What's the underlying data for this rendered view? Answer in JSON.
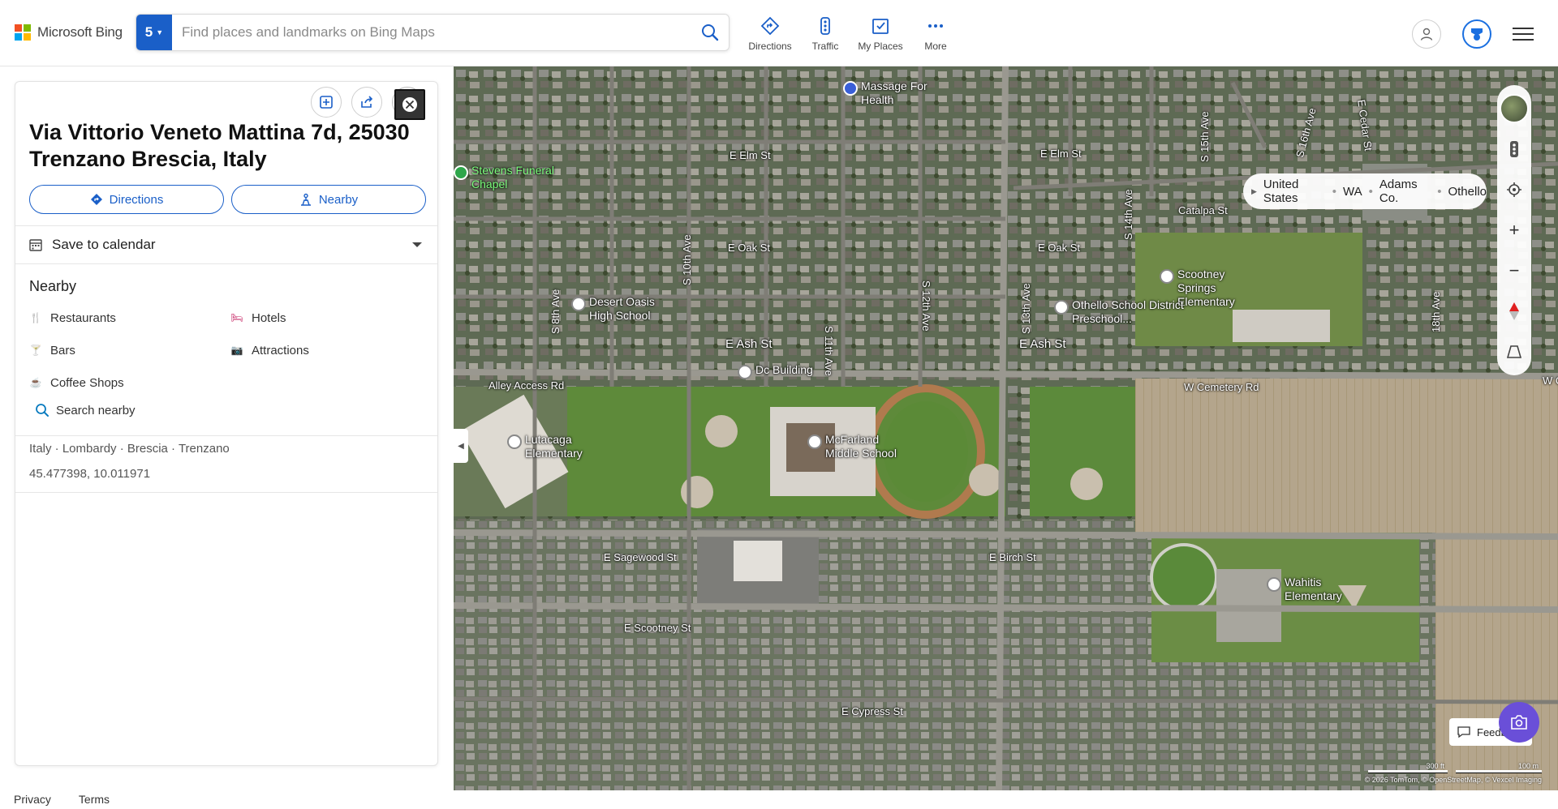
{
  "brand": {
    "name": "Microsoft Bing",
    "colors": [
      "#f25022",
      "#7fba00",
      "#00a4ef",
      "#ffb900"
    ]
  },
  "search": {
    "badge": "5",
    "placeholder": "Find places and landmarks on Bing Maps",
    "value": ""
  },
  "topnav": [
    {
      "label": "Directions",
      "icon": "directions-icon"
    },
    {
      "label": "Traffic",
      "icon": "traffic-icon"
    },
    {
      "label": "My Places",
      "icon": "my-places-icon"
    },
    {
      "label": "More",
      "icon": "more-icon"
    }
  ],
  "panel": {
    "title": "Via Vittorio Veneto Mattina 7d, 25030 Trenzano Brescia, Italy",
    "directions_label": "Directions",
    "nearby_button_label": "Nearby",
    "calendar_label": "Save to calendar",
    "nearby_title": "Nearby",
    "nearby_items": [
      {
        "label": "Restaurants",
        "icon": "fork-knife-icon",
        "color": "#e87722"
      },
      {
        "label": "Hotels",
        "icon": "bed-icon",
        "color": "#c2185b"
      },
      {
        "label": "Bars",
        "icon": "cocktail-icon",
        "color": "#e87722"
      },
      {
        "label": "Attractions",
        "icon": "camera-icon",
        "color": "#1a7fc8"
      },
      {
        "label": "Coffee Shops",
        "icon": "coffee-icon",
        "color": "#e87722"
      }
    ],
    "search_nearby_label": "Search nearby",
    "address_breadcrumb": "Italy · Lombardy · Brescia · Trenzano",
    "coordinates": "45.477398, 10.011971"
  },
  "footer": {
    "privacy": "Privacy",
    "terms": "Terms"
  },
  "map": {
    "breadcrumb": [
      "United States",
      "WA",
      "Adams Co.",
      "Othello"
    ],
    "streets": [
      {
        "name": "E Elm St"
      },
      {
        "name": "E Elm St "
      },
      {
        "name": "E Oak St"
      },
      {
        "name": "E Oak St "
      },
      {
        "name": "E Ash St"
      },
      {
        "name": "E Ash St "
      },
      {
        "name": "Alley Access Rd"
      },
      {
        "name": "W Cemetery Rd"
      },
      {
        "name": "Catalpa St"
      },
      {
        "name": "E Sagewood St"
      },
      {
        "name": "E Birch St"
      },
      {
        "name": "E Scootney St"
      },
      {
        "name": "E Cypress St"
      },
      {
        "name": "S 8th Ave"
      },
      {
        "name": "S 10th Ave"
      },
      {
        "name": "S 11th Ave"
      },
      {
        "name": "S 12th Ave"
      },
      {
        "name": "S 13th Ave"
      },
      {
        "name": "S 14th Ave"
      },
      {
        "name": "S 15th Ave"
      },
      {
        "name": "S 16th Ave"
      },
      {
        "name": "18th Ave"
      },
      {
        "name": "E Cedar St"
      },
      {
        "name": "W Ce"
      }
    ],
    "pois": [
      {
        "name": "Massage For Health"
      },
      {
        "name": "Stevens Funeral Chapel"
      },
      {
        "name": "Desert Oasis High School"
      },
      {
        "name": "Scootney Springs Elementary"
      },
      {
        "name": "Othello School District Preschool..."
      },
      {
        "name": "Dc Building"
      },
      {
        "name": "Lutacaga Elementary"
      },
      {
        "name": "McFarland Middle School"
      },
      {
        "name": "Wahitis Elementary"
      }
    ],
    "feedback_label": "Feedback",
    "scale_ft": "300 ft",
    "scale_m": "100 m",
    "copyright": "© 2026 TomTom, © OpenStreetMap, © Vexcel Imaging"
  }
}
